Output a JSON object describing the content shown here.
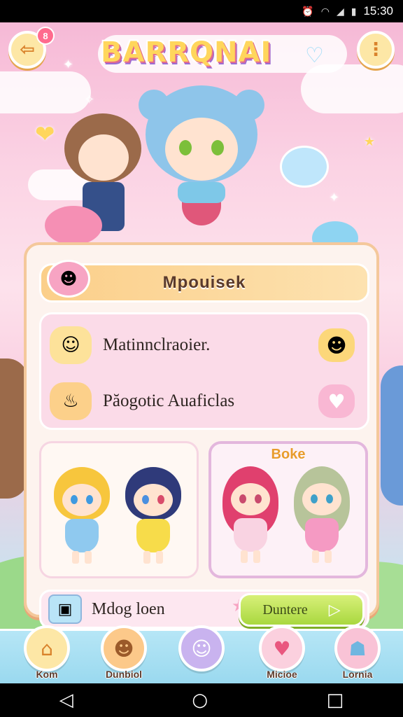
{
  "status_bar": {
    "time": "15:30",
    "icons": [
      "alarm-icon",
      "wifi-icon",
      "signal-icon",
      "battery-icon"
    ]
  },
  "header": {
    "back_badge": "8",
    "logo": "BARRQNAI",
    "icons": {
      "back": "back-arrow-icon",
      "heart": "heart-icon",
      "menu": "more-vertical-icon"
    }
  },
  "panel": {
    "title": "Mpouisek",
    "rows": [
      {
        "label": "Matinnclraoier.",
        "icon": "yellow-slime-icon",
        "action_icon": "chick-icon"
      },
      {
        "label": "Păogotic Auaficlas",
        "icon": "cake-stand-icon",
        "action_icon": "pink-heart-icon"
      }
    ],
    "cards": [
      {
        "title": "",
        "selected": false
      },
      {
        "title": "Boke",
        "selected": true
      }
    ],
    "footer": {
      "label": "Mdog loen",
      "button": "Duntere"
    }
  },
  "nav": {
    "items": [
      {
        "label": "Kom",
        "icon": "house-icon"
      },
      {
        "label": "Dunbiol",
        "icon": "bear-face-icon"
      },
      {
        "label": "",
        "icon": "cat-face-icon"
      },
      {
        "label": "Micioe",
        "icon": "heart-icon"
      },
      {
        "label": "Lornia",
        "icon": "profile-icon"
      }
    ]
  },
  "colors": {
    "accent_pink": "#f7a4c3",
    "accent_yellow": "#fde29a",
    "cta_green": "#a9d83f",
    "panel_bg": "#fdf3ee"
  }
}
